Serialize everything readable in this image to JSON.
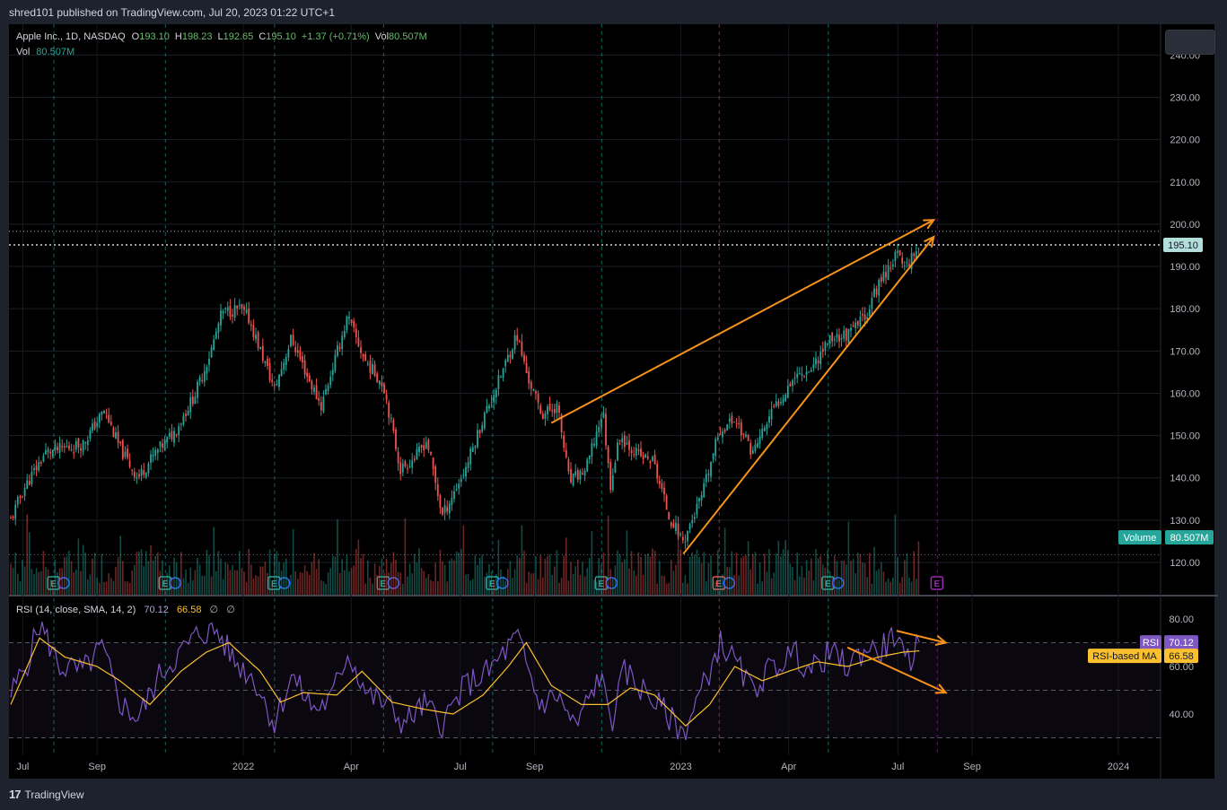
{
  "header": {
    "publisher_text": "shred101 published on TradingView.com, Jul 20, 2023 01:22 UTC+1"
  },
  "legend": {
    "symbol": "Apple Inc., 1D, NASDAQ",
    "o_label": "O",
    "o_value": "193.10",
    "h_label": "H",
    "h_value": "198.23",
    "l_label": "L",
    "l_value": "192.65",
    "c_label": "C",
    "c_value": "195.10",
    "change": "+1.37 (+0.71%)",
    "vol_label": "Vol",
    "vol_value": "80.507M",
    "vol_row_label": "Vol",
    "vol_row_value": "80.507M"
  },
  "rsi_legend": {
    "title": "RSI (14, close, SMA, 14, 2)",
    "rsi_value": "70.12",
    "ma_value": "66.58",
    "na1": "∅",
    "na2": "∅"
  },
  "badges": {
    "price_label": "195.10",
    "volume_label": "Volume",
    "volume_value": "80.507M",
    "rsi_label": "RSI",
    "rsi_value": "70.12",
    "ma_label": "RSI-based MA",
    "ma_value": "66.58"
  },
  "footer": {
    "brand": "TradingView"
  },
  "colors": {
    "up": "#26a69a",
    "down": "#ef5350",
    "arrow": "#f7931a",
    "rsi": "#7e57c2",
    "rsi_ma": "#fbc02d",
    "background": "#000000"
  },
  "chart_data": [
    {
      "type": "candlestick",
      "title": "Apple Inc., 1D, NASDAQ",
      "x_ticks": [
        "Jul",
        "Sep",
        "2022",
        "Apr",
        "Jul",
        "Sep",
        "2023",
        "Apr",
        "Jul",
        "Sep",
        "2024"
      ],
      "y_ticks": [
        "120.00",
        "130.00",
        "140.00",
        "150.00",
        "160.00",
        "170.00",
        "180.00",
        "190.00",
        "200.00",
        "210.00",
        "220.00",
        "230.00",
        "240.00"
      ],
      "ylim": [
        116,
        248
      ],
      "close_path": [
        [
          "2021-06-21",
          130
        ],
        [
          "2021-07-01",
          137
        ],
        [
          "2021-07-20",
          146
        ],
        [
          "2021-08-05",
          147
        ],
        [
          "2021-08-20",
          148
        ],
        [
          "2021-09-07",
          156
        ],
        [
          "2021-09-20",
          147
        ],
        [
          "2021-10-05",
          140
        ],
        [
          "2021-10-20",
          146
        ],
        [
          "2021-11-05",
          151
        ],
        [
          "2021-11-22",
          160
        ],
        [
          "2021-12-05",
          170
        ],
        [
          "2021-12-14",
          179
        ],
        [
          "2021-12-28",
          180
        ],
        [
          "2022-01-05",
          178
        ],
        [
          "2022-01-27",
          161
        ],
        [
          "2022-02-10",
          173
        ],
        [
          "2022-02-25",
          163
        ],
        [
          "2022-03-07",
          157
        ],
        [
          "2022-03-29",
          178
        ],
        [
          "2022-04-12",
          168
        ],
        [
          "2022-04-28",
          162
        ],
        [
          "2022-05-12",
          142
        ],
        [
          "2022-05-25",
          145
        ],
        [
          "2022-06-03",
          149
        ],
        [
          "2022-06-16",
          131
        ],
        [
          "2022-07-05",
          142
        ],
        [
          "2022-07-20",
          154
        ],
        [
          "2022-08-05",
          165
        ],
        [
          "2022-08-17",
          174
        ],
        [
          "2022-08-26",
          164
        ],
        [
          "2022-09-07",
          155
        ],
        [
          "2022-09-20",
          157
        ],
        [
          "2022-09-30",
          139
        ],
        [
          "2022-10-14",
          142
        ],
        [
          "2022-10-28",
          156
        ],
        [
          "2022-11-03",
          138
        ],
        [
          "2022-11-11",
          150
        ],
        [
          "2022-11-28",
          145
        ],
        [
          "2022-12-09",
          144
        ],
        [
          "2022-12-22",
          131
        ],
        [
          "2023-01-03",
          125
        ],
        [
          "2023-01-19",
          136
        ],
        [
          "2023-02-02",
          151
        ],
        [
          "2023-02-15",
          154
        ],
        [
          "2023-03-02",
          146
        ],
        [
          "2023-03-17",
          155
        ],
        [
          "2023-04-05",
          164
        ],
        [
          "2023-04-20",
          166
        ],
        [
          "2023-05-05",
          173
        ],
        [
          "2023-05-22",
          174
        ],
        [
          "2023-06-05",
          179
        ],
        [
          "2023-06-15",
          186
        ],
        [
          "2023-06-30",
          193
        ],
        [
          "2023-07-07",
          190
        ],
        [
          "2023-07-19",
          195.1
        ]
      ],
      "last_price": 195.1,
      "volume_last": "80.507M",
      "earnings_markers": [
        "2021-07-27",
        "2021-10-28",
        "2022-01-27",
        "2022-04-28",
        "2022-07-28",
        "2022-10-27",
        "2023-02-02",
        "2023-05-04",
        "2023-08-03"
      ],
      "trendlines": [
        {
          "from": [
            "2022-09-15",
            153
          ],
          "to": [
            "2023-07-31",
            201
          ],
          "arrow": true
        },
        {
          "from": [
            "2023-01-03",
            122
          ],
          "to": [
            "2023-07-31",
            197
          ],
          "arrow": true
        }
      ]
    },
    {
      "type": "line",
      "title": "RSI (14, close, SMA, 14, 2)",
      "y_ticks": [
        "40.00",
        "60.00",
        "80.00"
      ],
      "ylim": [
        26,
        86
      ],
      "bands": [
        30,
        50,
        70
      ],
      "series": [
        {
          "name": "RSI",
          "last": 70.12,
          "values": [
            [
              "2021-06-21",
              48
            ],
            [
              "2021-07-05",
              62
            ],
            [
              "2021-07-15",
              78
            ],
            [
              "2021-08-01",
              60
            ],
            [
              "2021-08-20",
              58
            ],
            [
              "2021-09-05",
              68
            ],
            [
              "2021-09-20",
              45
            ],
            [
              "2021-10-05",
              38
            ],
            [
              "2021-10-25",
              58
            ],
            [
              "2021-11-10",
              66
            ],
            [
              "2021-11-25",
              74
            ],
            [
              "2021-12-10",
              75
            ],
            [
              "2021-12-25",
              62
            ],
            [
              "2022-01-10",
              55
            ],
            [
              "2022-01-27",
              36
            ],
            [
              "2022-02-10",
              56
            ],
            [
              "2022-03-01",
              42
            ],
            [
              "2022-03-15",
              46
            ],
            [
              "2022-03-29",
              66
            ],
            [
              "2022-04-15",
              48
            ],
            [
              "2022-05-01",
              44
            ],
            [
              "2022-05-15",
              36
            ],
            [
              "2022-06-01",
              44
            ],
            [
              "2022-06-16",
              36
            ],
            [
              "2022-07-05",
              52
            ],
            [
              "2022-07-25",
              58
            ],
            [
              "2022-08-10",
              68
            ],
            [
              "2022-08-18",
              72
            ],
            [
              "2022-09-05",
              44
            ],
            [
              "2022-09-20",
              48
            ],
            [
              "2022-10-05",
              34
            ],
            [
              "2022-10-25",
              56
            ],
            [
              "2022-11-05",
              38
            ],
            [
              "2022-11-15",
              58
            ],
            [
              "2022-12-05",
              48
            ],
            [
              "2022-12-20",
              40
            ],
            [
              "2023-01-03",
              32
            ],
            [
              "2023-01-20",
              52
            ],
            [
              "2023-02-03",
              70
            ],
            [
              "2023-02-15",
              62
            ],
            [
              "2023-03-01",
              50
            ],
            [
              "2023-03-15",
              58
            ],
            [
              "2023-04-05",
              66
            ],
            [
              "2023-04-20",
              58
            ],
            [
              "2023-05-05",
              66
            ],
            [
              "2023-05-20",
              60
            ],
            [
              "2023-06-05",
              68
            ],
            [
              "2023-06-15",
              66
            ],
            [
              "2023-06-30",
              74
            ],
            [
              "2023-07-07",
              60
            ],
            [
              "2023-07-19",
              70.12
            ]
          ]
        },
        {
          "name": "RSI-based MA",
          "last": 66.58,
          "values": [
            [
              "2021-06-21",
              44
            ],
            [
              "2021-07-15",
              72
            ],
            [
              "2021-08-05",
              64
            ],
            [
              "2021-09-01",
              60
            ],
            [
              "2021-09-20",
              54
            ],
            [
              "2021-10-15",
              44
            ],
            [
              "2021-11-10",
              58
            ],
            [
              "2021-12-01",
              66
            ],
            [
              "2021-12-20",
              70
            ],
            [
              "2022-01-15",
              58
            ],
            [
              "2022-02-01",
              45
            ],
            [
              "2022-02-20",
              49
            ],
            [
              "2022-03-20",
              48
            ],
            [
              "2022-04-10",
              58
            ],
            [
              "2022-05-05",
              45
            ],
            [
              "2022-06-01",
              42
            ],
            [
              "2022-06-25",
              40
            ],
            [
              "2022-07-20",
              48
            ],
            [
              "2022-08-10",
              60
            ],
            [
              "2022-08-25",
              70
            ],
            [
              "2022-09-15",
              52
            ],
            [
              "2022-10-10",
              44
            ],
            [
              "2022-11-01",
              44
            ],
            [
              "2022-11-20",
              51
            ],
            [
              "2022-12-10",
              48
            ],
            [
              "2023-01-05",
              35
            ],
            [
              "2023-01-25",
              44
            ],
            [
              "2023-02-15",
              60
            ],
            [
              "2023-03-10",
              54
            ],
            [
              "2023-04-01",
              58
            ],
            [
              "2023-04-25",
              62
            ],
            [
              "2023-05-20",
              60
            ],
            [
              "2023-06-15",
              64
            ],
            [
              "2023-07-05",
              66
            ],
            [
              "2023-07-19",
              66.58
            ]
          ]
        }
      ],
      "divergence_arrows": [
        {
          "from": [
            "2023-05-20",
            68
          ],
          "to": [
            "2023-08-10",
            49
          ]
        },
        {
          "from": [
            "2023-06-30",
            75
          ],
          "to": [
            "2023-08-10",
            70
          ]
        }
      ]
    }
  ]
}
